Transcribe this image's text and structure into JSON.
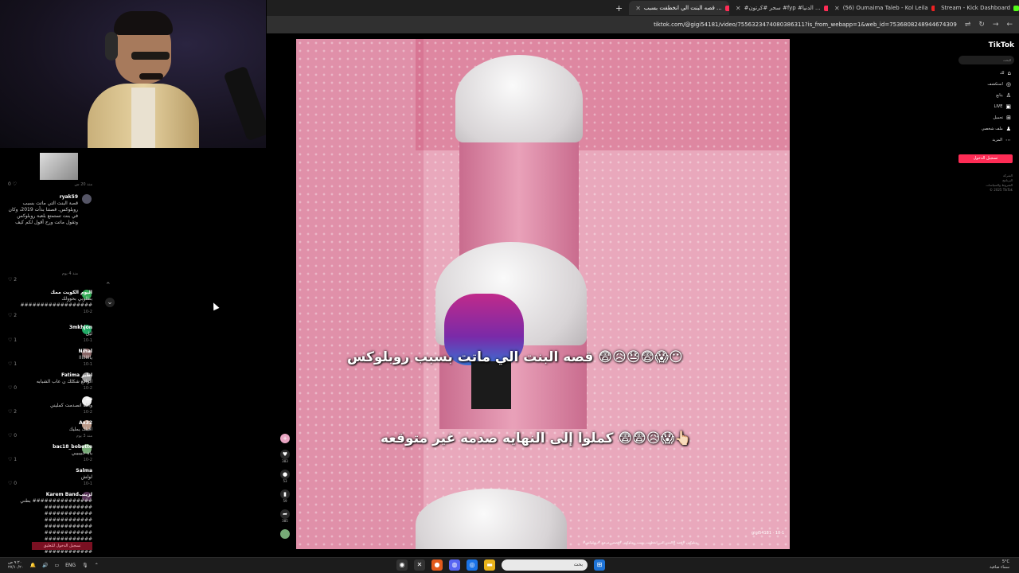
{
  "browser": {
    "tabs": [
      {
        "label": "قصه البنت الي انخطفت بسبب ...",
        "active": true
      },
      {
        "label": "#سحر #كرتون #fyp #الدنيا ...",
        "active": false
      },
      {
        "label": "(56) Oumaima Taleb - Kol Leila",
        "active": false
      },
      {
        "label": "Stream - Kick Dashboard",
        "active": false
      }
    ],
    "url": "tiktok.com/@gigi54181/video/7556323474080386311?is_from_webapp=1&web_id=7536808248944674309"
  },
  "chat": {
    "comments": [
      {
        "user": "ryak59",
        "text": "قصة البنت التي ماتت بسبب روبلوكس. قصتنا بدأت 2019، وكان في بنت تستمتع بلعبة روبلوكس وتقول ماتت ورح أقول لكم كيف",
        "meta": "منذ 4 يوم",
        "likes": "2"
      },
      {
        "user": "اليوم الكويت ممك",
        "text": "بطلوبي بحوولك",
        "meta": "10-2",
        "likes": "2"
      },
      {
        "user": "3mkhjon",
        "text": "ليل",
        "meta": "10-1",
        "likes": "1"
      },
      {
        "user": "Nihal",
        "text": "يااااااااا",
        "meta": "10-1",
        "likes": "1"
      },
      {
        "user": "Fatima اطير",
        "text": "الواقع شكلك ن عاب الشبابه",
        "meta": "10-2",
        "likes": "0"
      },
      {
        "user": "aa",
        "text": "والله انصدمت كمليني",
        "meta": "10-2",
        "likes": "2"
      },
      {
        "user": "Ax32",
        "text": "اقبلك يمليك",
        "meta": "منذ 3 يوم",
        "likes": "0"
      },
      {
        "user": "bac18_bobette",
        "text": "ياه حبيبيبي",
        "meta": "10-2",
        "likes": "1"
      },
      {
        "user": "Salma",
        "text": "لولش",
        "meta": "10-1",
        "likes": "0"
      },
      {
        "user": "Karem Bandلزينب",
        "text": "بطني ###############",
        "meta": "",
        "likes": ""
      }
    ],
    "reply_label": "تسجيل الدخول للتعليق",
    "top_meta": "منذ 20 س"
  },
  "video": {
    "caption_top": "قصه البنت الي ماتت بسبب روبلوكس 😨😥😓😨😱😶",
    "caption_bottom": "كملوا إلى النهايه صدمه غير متوقعه 😨😨😥😱👆🏻",
    "author": "gigi54181",
    "timestamp": "10-1",
    "hashtags": "#روبلوكس #قصه #البنت_التي_انخطفت_بسبب_روبلوكس #قصص_مرعبه #روبلوكس"
  },
  "actions": {
    "likes": "383",
    "comments": "53",
    "saves": "59",
    "shares": "385"
  },
  "tiktok": {
    "logo": "TikTok",
    "search_placeholder": "البحث",
    "nav": [
      "لك",
      "استكشف",
      "يتابع",
      "LIVE",
      "تحميل",
      "ملف شخصي",
      "المزيد"
    ],
    "login": "تسجيل الدخول",
    "footer": [
      "الشركة",
      "البرنامج",
      "الشروط والسياسات",
      "© 2025 TikTok"
    ]
  },
  "taskbar": {
    "lang": "ENG",
    "search": "بحث",
    "weather_temp": "5°C",
    "weather_text": "سماء صافية",
    "time": "٩:٢٠ ص",
    "date": "٢٧/١٠/٢٠"
  }
}
